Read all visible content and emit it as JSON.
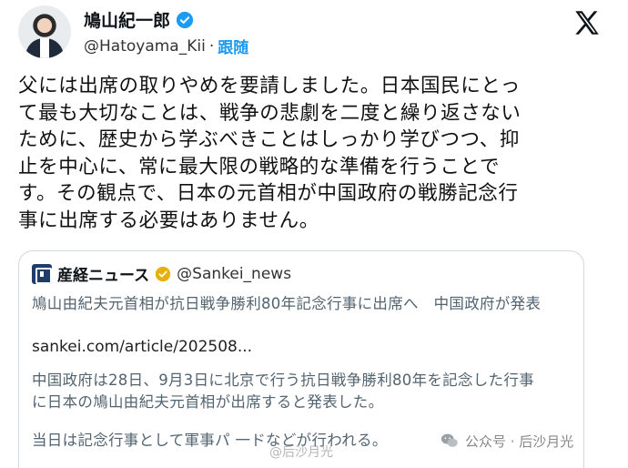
{
  "author": {
    "name": "鳩山紀一郎",
    "handle": "@Hatoyama_Kii",
    "follow_label": "跟随"
  },
  "tweet": {
    "lines": [
      "父には出席の取りやめを要請しました。日本国民にとっ",
      "て最も大切なことは、戦争の悲劇を二度と繰り返さない",
      "ために、歴史から学ぶべきことはしっかり学びつつ、抑",
      "止を中心に、常に最大限の戦略的な準備を行うことで",
      "す。その観点で、日本の元首相が中国政府の戦勝記念行",
      "事に出席する必要はありません。"
    ]
  },
  "quote": {
    "name": "産経ニュース",
    "handle": "@Sankei_news",
    "headline": "鳩山由紀夫元首相が抗日戦争勝利80年記念行事に出席へ　中国政府が発表",
    "link": "sankei.com/article/202508...",
    "body_lines": [
      "中国政府は28日、9月3日に北京で行う抗日戦争勝利80年を記念した行事",
      "に日本の鳩山由紀夫元首相が出席すると発表した。"
    ],
    "body_lines_2": [
      "当日は記念行事として軍事パ 一ドなどが行われる。"
    ]
  },
  "watermark": {
    "text": "公众号 · 后沙月光",
    "overlay": "@后沙月光"
  },
  "colors": {
    "verified": "#1d9bf0",
    "quote_verified": "#e8b10a",
    "follow": "#1d9bf0"
  }
}
